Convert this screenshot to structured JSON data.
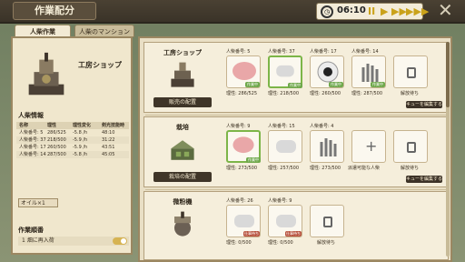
{
  "window": {
    "title": "作業配分"
  },
  "topbar": {
    "time": "06:10",
    "pause": "II",
    "play": "▶",
    "fast": "▶▶",
    "faster": "▶▶▶",
    "close": "✕"
  },
  "tabs": {
    "tab1": "人柴作業",
    "tab2": "人柴のマンション"
  },
  "left": {
    "facility_name": "工房ショップ",
    "info_title": "人柴情報",
    "headers": [
      "名称",
      "理性",
      "理性変化",
      "剣光技能時"
    ],
    "rows": [
      [
        "人柴番号: 5",
        "286/525",
        "-5.8 /h",
        "48:10"
      ],
      [
        "人柴番号: 37",
        "218/500",
        "-5.9 /h",
        "31:22"
      ],
      [
        "人柴番号: 17",
        "260/500",
        "-5.9 /h",
        "43:51"
      ],
      [
        "人柴番号: 14",
        "287/500",
        "-5.8 /h",
        "45:05"
      ]
    ],
    "oil": "オイル×1",
    "task_title": "作業順番",
    "task_row": "1      畑に再入荷"
  },
  "cards": [
    {
      "title": "工房ショップ",
      "button": "販売の配置",
      "slots": [
        {
          "label": "人柴番号: 5",
          "status": "理性: 286/525",
          "badge": "作業中"
        },
        {
          "label": "人柴番号: 37",
          "status": "理性: 218/500",
          "badge": "作業中"
        },
        {
          "label": "人柴番号: 17",
          "status": "理性: 260/500",
          "badge": "作業中"
        },
        {
          "label": "人柴番号: 14",
          "status": "理性: 287/500",
          "badge": "作業中"
        },
        {
          "label": "",
          "status": "解放待ち",
          "badge": ""
        }
      ],
      "queue": "キューを編集する"
    },
    {
      "title": "栽培",
      "button": "栽培の配置",
      "slots": [
        {
          "label": "人柴番号: 9",
          "status": "理性: 273/500",
          "badge": "作業中"
        },
        {
          "label": "人柴番号: 15",
          "status": "理性: 257/500",
          "badge": ""
        },
        {
          "label": "人柴番号: 4",
          "status": "理性: 273/500",
          "badge": ""
        },
        {
          "label": "",
          "status": "派遣可能な人柴",
          "badge": ""
        },
        {
          "label": "",
          "status": "解放待ち",
          "badge": ""
        }
      ],
      "queue": "キューを編集する"
    },
    {
      "title": "微粉機",
      "button": "",
      "slots": [
        {
          "label": "人柴番号: 26",
          "status": "理性: 0/500",
          "badge": "仕事待ち"
        },
        {
          "label": "人柴番号: 9",
          "status": "理性: 0/500",
          "badge": "仕事待ち"
        },
        {
          "label": "",
          "status": "解放待ち",
          "badge": ""
        }
      ],
      "queue": ""
    }
  ]
}
